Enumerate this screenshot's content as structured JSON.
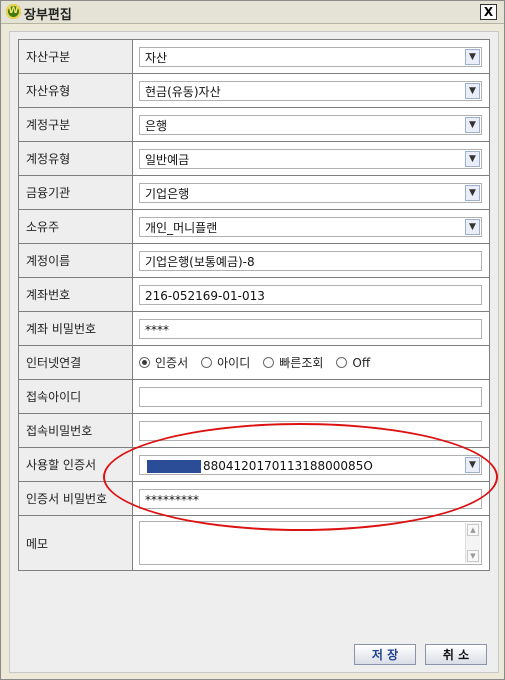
{
  "window": {
    "title": "장부편집",
    "app_icon": "W",
    "close_symbol": "X"
  },
  "fields": {
    "asset_category": {
      "label": "자산구분",
      "value": "자산"
    },
    "asset_type": {
      "label": "자산유형",
      "value": "현금(유동)자산"
    },
    "account_category": {
      "label": "계정구분",
      "value": "은행"
    },
    "account_type": {
      "label": "계정유형",
      "value": "일반예금"
    },
    "institution": {
      "label": "금융기관",
      "value": "기업은행"
    },
    "owner": {
      "label": "소유주",
      "value": "개인_머니플랜"
    },
    "account_name": {
      "label": "계정이름",
      "value": "기업은행(보통예금)-8"
    },
    "account_number": {
      "label": "계좌번호",
      "value": "216-052169-01-013"
    },
    "account_password": {
      "label": "계좌 비밀번호",
      "value": "****"
    },
    "internet_link": {
      "label": "인터넷연결",
      "options": [
        "인증서",
        "아이디",
        "빠른조회",
        "Off"
      ],
      "selected": "인증서"
    },
    "login_id": {
      "label": "접속아이디",
      "value": ""
    },
    "login_password": {
      "label": "접속비밀번호",
      "value": ""
    },
    "certificate": {
      "label": "사용할 인증서",
      "value": "880412017011318800085O"
    },
    "certificate_password": {
      "label": "인증서 비밀번호",
      "value": "*********"
    },
    "memo": {
      "label": "메모",
      "value": ""
    }
  },
  "buttons": {
    "save": "저 장",
    "cancel": "취 소"
  },
  "icons": {
    "dropdown": "chevron-down-icon",
    "scroll_up": "arrow-up-icon",
    "scroll_down": "arrow-down-icon"
  },
  "colors": {
    "highlight_ellipse": "#dd1111",
    "redaction": "#2b4c96",
    "save_text": "#1f3f8f"
  }
}
